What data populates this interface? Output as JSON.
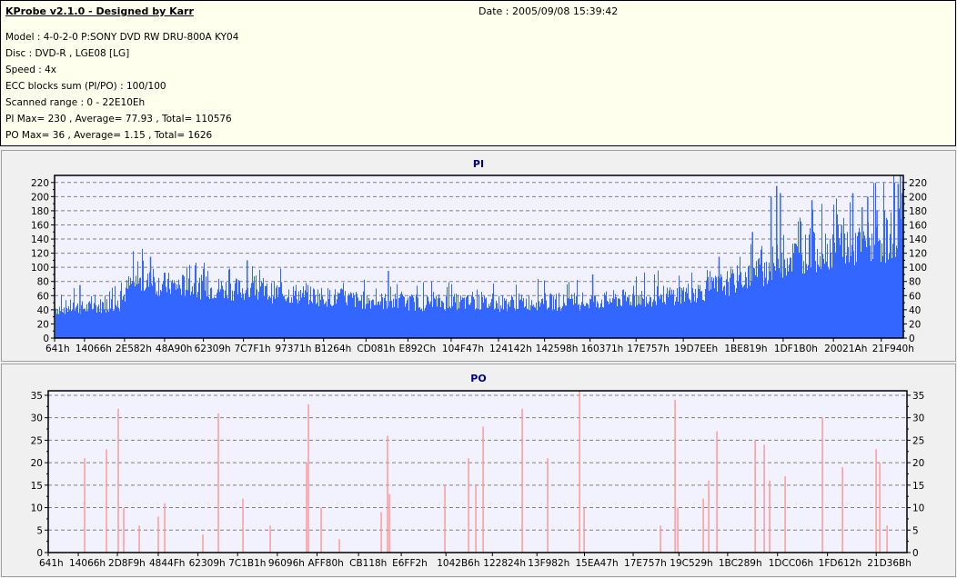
{
  "info": {
    "title": "KProbe v2.1.0 - Designed by Karr",
    "date": "Date : 2005/09/08 15:39:42",
    "lines": [
      "Model : 4-0-2-0 P:SONY    DVD RW DRU-800A  KY04",
      "Disc : DVD-R , LGE08 [LG]",
      "Speed : 4x",
      "ECC blocks sum (PI/PO) : 100/100",
      "Scanned range : 0 - 22E10Eh",
      "PI Max= 230 , Average= 77.93 , Total= 110576",
      "PO Max= 36 , Average= 1.15 , Total= 1626"
    ]
  },
  "chart_data": [
    {
      "type": "bar",
      "title": "PI",
      "color": "#3366ff",
      "background": "#f2f2ff",
      "grid": true,
      "xlim_hex": [
        "641",
        "22E10E"
      ],
      "ylim": [
        0,
        230
      ],
      "yticks": [
        0,
        20,
        40,
        60,
        80,
        100,
        120,
        140,
        160,
        180,
        200,
        220
      ],
      "xtick_labels": [
        "641h",
        "14066h",
        "2E582h",
        "48A90h",
        "62309h",
        "7C7F1h",
        "97371h",
        "B1264h",
        "CD081h",
        "E892Ch",
        "104F47h",
        "124142h",
        "142598h",
        "160371h",
        "17E757h",
        "19D7EEh",
        "1BE819h",
        "1DF1B0h",
        "20021Ah",
        "21F940h"
      ],
      "level_samples": [
        45,
        47,
        48,
        46,
        47,
        50,
        52,
        52,
        80,
        85,
        85,
        83,
        82,
        80,
        80,
        78,
        78,
        76,
        76,
        75,
        74,
        72,
        72,
        70,
        70,
        68,
        68,
        66,
        65,
        64,
        62,
        62,
        60,
        58,
        58,
        57,
        56,
        56,
        55,
        55,
        54,
        54,
        55,
        55,
        55,
        54,
        54,
        53,
        53,
        54,
        55,
        55,
        56,
        56,
        55,
        55,
        55,
        55,
        56,
        57,
        58,
        60,
        60,
        62,
        62,
        64,
        65,
        66,
        68,
        70,
        72,
        76,
        80,
        85,
        90,
        95,
        100,
        105,
        115,
        120,
        125,
        130,
        130,
        135,
        138,
        140,
        140,
        142,
        145,
        148,
        150,
        160,
        185
      ],
      "spikes": [
        [
          70000,
          75
        ],
        [
          260000,
          115
        ],
        [
          520000,
          110
        ],
        [
          900000,
          95
        ],
        [
          1450000,
          90
        ],
        [
          1790000,
          115
        ],
        [
          1880000,
          150
        ],
        [
          1930000,
          200
        ],
        [
          1945000,
          215
        ],
        [
          1955000,
          205
        ],
        [
          2010000,
          165
        ],
        [
          2040000,
          195
        ],
        [
          2120000,
          160
        ],
        [
          2150000,
          205
        ],
        [
          2175000,
          185
        ],
        [
          2190000,
          200
        ],
        [
          2215000,
          180
        ],
        [
          2235000,
          180
        ],
        [
          2262000,
          220
        ],
        [
          2272000,
          218
        ],
        [
          2278000,
          230
        ],
        [
          2283000,
          205
        ]
      ]
    },
    {
      "type": "bar",
      "title": "PO",
      "color": "#ff9999",
      "background": "#f2f2ff",
      "grid": true,
      "xlim": [
        1601,
        2299000
      ],
      "ylim": [
        0,
        36
      ],
      "yticks": [
        0,
        5,
        10,
        15,
        20,
        25,
        30,
        35
      ],
      "xtick_labels": [
        "641h",
        "14066h",
        "2D8F9h",
        "4844Fh",
        "62309h",
        "7C1B1h",
        "96096h",
        "AFF80h",
        "CB118h",
        "E6FF2h",
        "1042B6h",
        "122824h",
        "13F982h",
        "15EA47h",
        "17E757h",
        "19C529h",
        "1BC289h",
        "1DCC06h",
        "1FD612h",
        "21D36Bh"
      ],
      "spikes": [
        [
          98961,
          21
        ],
        [
          157377,
          23
        ],
        [
          189019,
          32
        ],
        [
          203623,
          10
        ],
        [
          245001,
          6
        ],
        [
          296115,
          8
        ],
        [
          313153,
          11
        ],
        [
          415381,
          4
        ],
        [
          456759,
          31
        ],
        [
          522477,
          12
        ],
        [
          595497,
          6
        ],
        [
          692857,
          20
        ],
        [
          697725,
          33
        ],
        [
          731801,
          10
        ],
        [
          780481,
          3
        ],
        [
          892445,
          9
        ],
        [
          909483,
          26
        ],
        [
          914351,
          13
        ],
        [
          1062825,
          15
        ],
        [
          1126109,
          21
        ],
        [
          1145581,
          15
        ],
        [
          1165053,
          28
        ],
        [
          1269715,
          32
        ],
        [
          1337867,
          21
        ],
        [
          1423057,
          36
        ],
        [
          1435227,
          10
        ],
        [
          1639683,
          6
        ],
        [
          1678627,
          34
        ],
        [
          1685929,
          10
        ],
        [
          1754081,
          12
        ],
        [
          1768685,
          16
        ],
        [
          1790591,
          27
        ],
        [
          1892819,
          25
        ],
        [
          1917159,
          24
        ],
        [
          1931763,
          16
        ],
        [
          1973141,
          17
        ],
        [
          2072935,
          30
        ],
        [
          2126483,
          19
        ],
        [
          2216541,
          23
        ],
        [
          2226277,
          20
        ],
        [
          2245749,
          6
        ]
      ]
    }
  ]
}
